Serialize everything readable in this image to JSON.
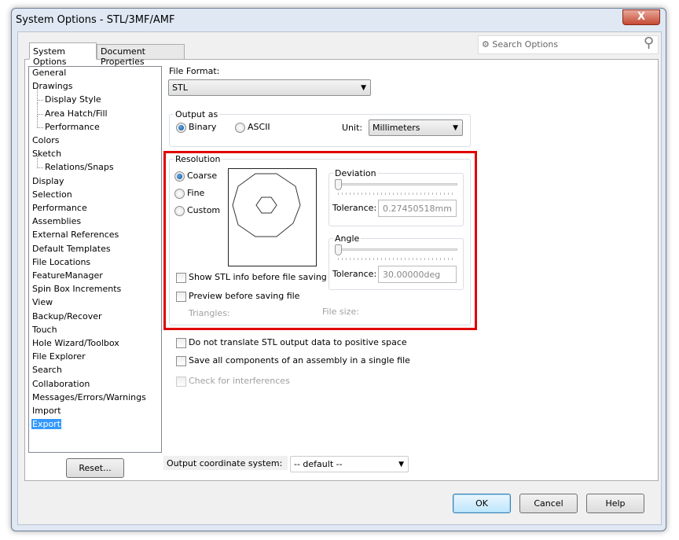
{
  "window": {
    "title": "System Options - STL/3MF/AMF",
    "close": "X"
  },
  "tabs": [
    {
      "label": "System Options"
    },
    {
      "label": "Document Properties"
    }
  ],
  "search": {
    "placeholder": "Search Options"
  },
  "tree": [
    "General",
    "Drawings",
    "Display Style",
    "Area Hatch/Fill",
    "Performance",
    "Colors",
    "Sketch",
    "Relations/Snaps",
    "Display",
    "Selection",
    "Performance",
    "Assemblies",
    "External References",
    "Default Templates",
    "File Locations",
    "FeatureManager",
    "Spin Box Increments",
    "View",
    "Backup/Recover",
    "Touch",
    "Hole Wizard/Toolbox",
    "File Explorer",
    "Search",
    "Collaboration",
    "Messages/Errors/Warnings",
    "Import",
    "Export"
  ],
  "tree_sub": [
    2,
    3,
    4,
    7
  ],
  "tree_selected": 26,
  "file_format": {
    "label": "File Format:",
    "value": "STL"
  },
  "output_as": {
    "label": "Output as",
    "binary": "Binary",
    "ascii": "ASCII",
    "unit_label": "Unit:",
    "unit": "Millimeters"
  },
  "resolution": {
    "label": "Resolution",
    "coarse": "Coarse",
    "fine": "Fine",
    "custom": "Custom",
    "selected": "coarse",
    "deviation": {
      "label": "Deviation",
      "tolerance_label": "Tolerance:",
      "tolerance": "0.27450518mm",
      "slider": 0
    },
    "angle": {
      "label": "Angle",
      "tolerance_label": "Tolerance:",
      "tolerance": "30.00000deg",
      "slider": 0
    },
    "show_info": "Show STL info before file saving",
    "preview": "Preview before saving file",
    "triangles": "Triangles:",
    "file_size": "File size:"
  },
  "options": {
    "no_translate": "Do not translate STL output data to positive space",
    "save_all": "Save all components of an assembly in a single file",
    "interferences": "Check for interferences"
  },
  "coord": {
    "label": "Output coordinate system:",
    "value": "-- default --"
  },
  "buttons": {
    "reset": "Reset...",
    "ok": "OK",
    "cancel": "Cancel",
    "help": "Help"
  },
  "colors": {
    "highlight": "#e00000",
    "selection": "#3399ff"
  }
}
